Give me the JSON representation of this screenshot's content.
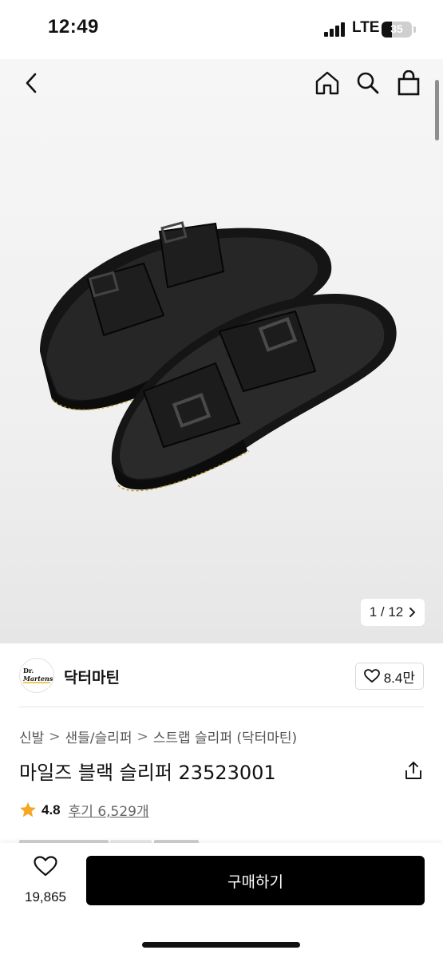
{
  "status_bar": {
    "time": "12:49",
    "network": "LTE",
    "battery_percent": "35",
    "battery_level": 0.35
  },
  "nav": {
    "back_icon": "chevron-left-icon",
    "home_icon": "home-icon",
    "search_icon": "search-icon",
    "cart_icon": "shopping-bag-icon"
  },
  "gallery": {
    "current": "1",
    "total": "12",
    "counter_label": "1 / 12",
    "image": "black-double-buckle-slide-sandals"
  },
  "brand": {
    "logo_text_top": "Dr.",
    "logo_text": "Martens",
    "name": "닥터마틴",
    "like_count": "8.4만"
  },
  "breadcrumb": [
    "신발",
    "샌들/슬리퍼",
    "스트랩 슬리퍼 (닥터마틴)"
  ],
  "breadcrumb_sep": ">",
  "product": {
    "title": "마일즈 블랙 슬리퍼 23523001",
    "rating": "4.8",
    "review_label": "후기 6,529개"
  },
  "bottom_bar": {
    "wish_count": "19,865",
    "buy_label": "구매하기"
  },
  "colors": {
    "star": "#f5a623",
    "buy_button": "#000000"
  }
}
